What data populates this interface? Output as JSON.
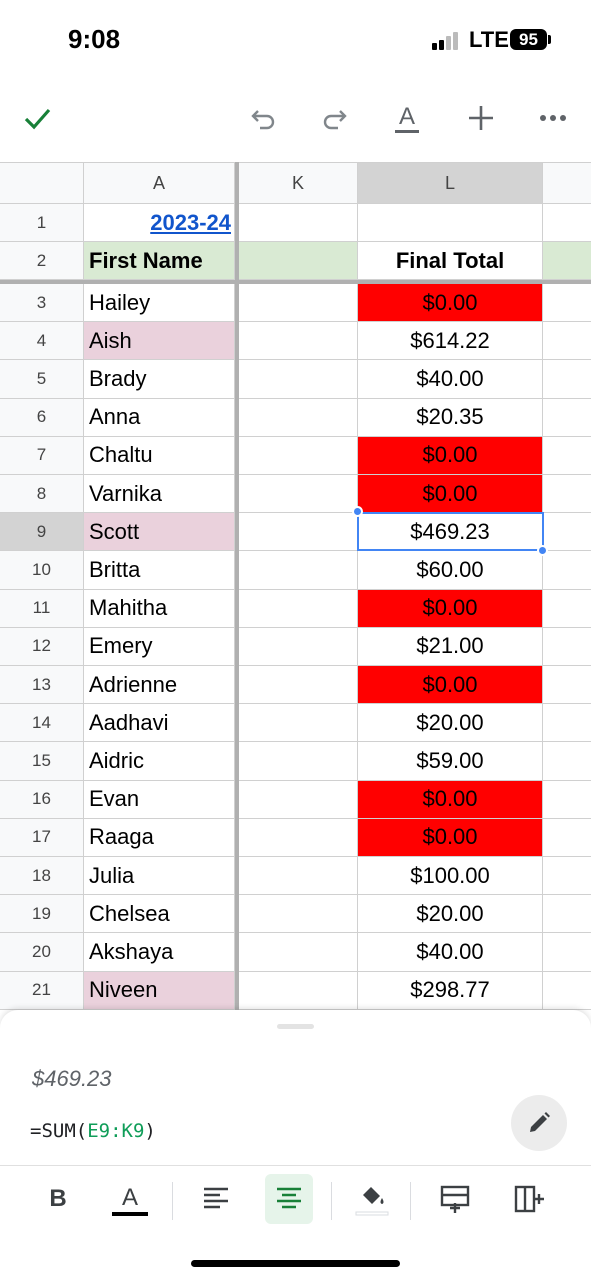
{
  "status": {
    "time": "9:08",
    "network": "LTE",
    "battery": "95"
  },
  "toolbar": {
    "icons": [
      "check-icon",
      "undo-icon",
      "redo-icon",
      "text-format-icon",
      "add-icon",
      "more-icon"
    ],
    "accent": "#188038"
  },
  "columns": [
    {
      "id": "A",
      "label": "A"
    },
    {
      "id": "K",
      "label": "K"
    },
    {
      "id": "L",
      "label": "L"
    }
  ],
  "rows": [
    {
      "n": "1",
      "a": "2023-24",
      "l": ""
    },
    {
      "n": "2",
      "a": "First Name",
      "l": "Final Total"
    },
    {
      "n": "3",
      "a": "Hailey",
      "l": "$0.00"
    },
    {
      "n": "4",
      "a": "Aish",
      "l": "$614.22"
    },
    {
      "n": "5",
      "a": "Brady",
      "l": "$40.00"
    },
    {
      "n": "6",
      "a": "Anna",
      "l": "$20.35"
    },
    {
      "n": "7",
      "a": "Chaltu",
      "l": "$0.00"
    },
    {
      "n": "8",
      "a": "Varnika",
      "l": "$0.00"
    },
    {
      "n": "9",
      "a": "Scott",
      "l": "$469.23"
    },
    {
      "n": "10",
      "a": "Britta",
      "l": "$60.00"
    },
    {
      "n": "11",
      "a": "Mahitha",
      "l": "$0.00"
    },
    {
      "n": "12",
      "a": "Emery",
      "l": "$21.00"
    },
    {
      "n": "13",
      "a": "Adrienne",
      "l": "$0.00"
    },
    {
      "n": "14",
      "a": "Aadhavi",
      "l": "$20.00"
    },
    {
      "n": "15",
      "a": "Aidric",
      "l": "$59.00"
    },
    {
      "n": "16",
      "a": "Evan",
      "l": "$0.00"
    },
    {
      "n": "17",
      "a": "Raaga",
      "l": "$0.00"
    },
    {
      "n": "18",
      "a": "Julia",
      "l": "$100.00"
    },
    {
      "n": "19",
      "a": "Chelsea",
      "l": "$20.00"
    },
    {
      "n": "20",
      "a": "Akshaya",
      "l": "$40.00"
    },
    {
      "n": "21",
      "a": "Niveen",
      "l": "$298.77"
    }
  ],
  "colors": {
    "red_fill": "#ff0000",
    "pink_fill": "#ead1dc",
    "header_green": "#d9ead3",
    "selection": "#4285f4",
    "link": "#1155cc"
  },
  "selected_cell": "L9",
  "formula_bar": {
    "value": "$469.23",
    "formula_prefix": "=SUM(",
    "formula_range": "E9:K9",
    "formula_suffix": ")"
  },
  "format_bar": {
    "icons": [
      "bold-icon",
      "text-color-icon",
      "align-left-icon",
      "align-center-icon",
      "fill-color-icon",
      "insert-row-icon",
      "insert-column-icon"
    ],
    "bold_label": "B",
    "text_color_label": "A"
  }
}
